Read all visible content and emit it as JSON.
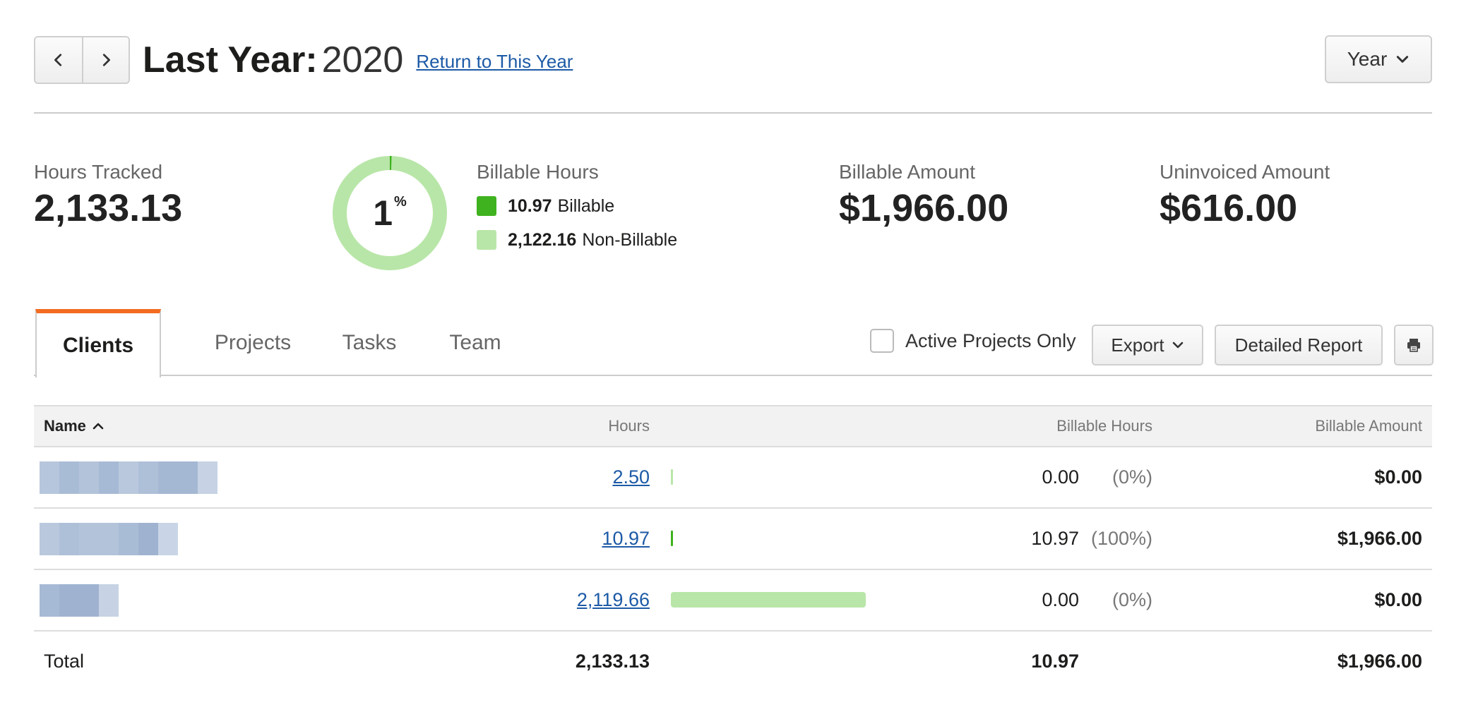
{
  "header": {
    "title_label": "Last Year:",
    "title_year": "2020",
    "return_link": "Return to This Year",
    "period_button": "Year"
  },
  "stats": {
    "hours_tracked_label": "Hours Tracked",
    "hours_tracked_value": "2,133.13",
    "donut_percent": "1",
    "donut_percent_sign": "%",
    "billable_fraction": 0.0051,
    "billable_hours_label": "Billable Hours",
    "billable_value": "10.97",
    "billable_text": "Billable",
    "nonbillable_value": "2,122.16",
    "nonbillable_text": "Non-Billable",
    "billable_amount_label": "Billable Amount",
    "billable_amount_value": "$1,966.00",
    "uninvoiced_label": "Uninvoiced Amount",
    "uninvoiced_value": "$616.00"
  },
  "colors": {
    "billable": "#3fb21f",
    "nonbillable": "#b8e6a8",
    "active_tab_accent": "#f36c21",
    "link": "#1d5aa6"
  },
  "tabs": [
    {
      "label": "Clients",
      "active": true
    },
    {
      "label": "Projects",
      "active": false
    },
    {
      "label": "Tasks",
      "active": false
    },
    {
      "label": "Team",
      "active": false
    }
  ],
  "toolbar": {
    "active_projects_label": "Active Projects Only",
    "export_label": "Export",
    "detailed_report_label": "Detailed Report",
    "print_icon": "print-icon"
  },
  "table": {
    "headers": {
      "name": "Name",
      "hours": "Hours",
      "billable_hours": "Billable Hours",
      "billable_amount": "Billable Amount"
    },
    "rows": [
      {
        "hours": "2.50",
        "bar_fraction": 0.0012,
        "bar_type": "nonbillable",
        "billable_hours": "0.00",
        "billable_pct": "(0%)",
        "billable_amount": "$0.00"
      },
      {
        "hours": "10.97",
        "bar_fraction": 0.0052,
        "bar_type": "billable",
        "billable_hours": "10.97",
        "billable_pct": "(100%)",
        "billable_amount": "$1,966.00"
      },
      {
        "hours": "2,119.66",
        "bar_fraction": 1.0,
        "bar_type": "nonbillable",
        "billable_hours": "0.00",
        "billable_pct": "(0%)",
        "billable_amount": "$0.00"
      }
    ],
    "total": {
      "label": "Total",
      "hours": "2,133.13",
      "billable_hours": "10.97",
      "billable_amount": "$1,966.00"
    }
  }
}
